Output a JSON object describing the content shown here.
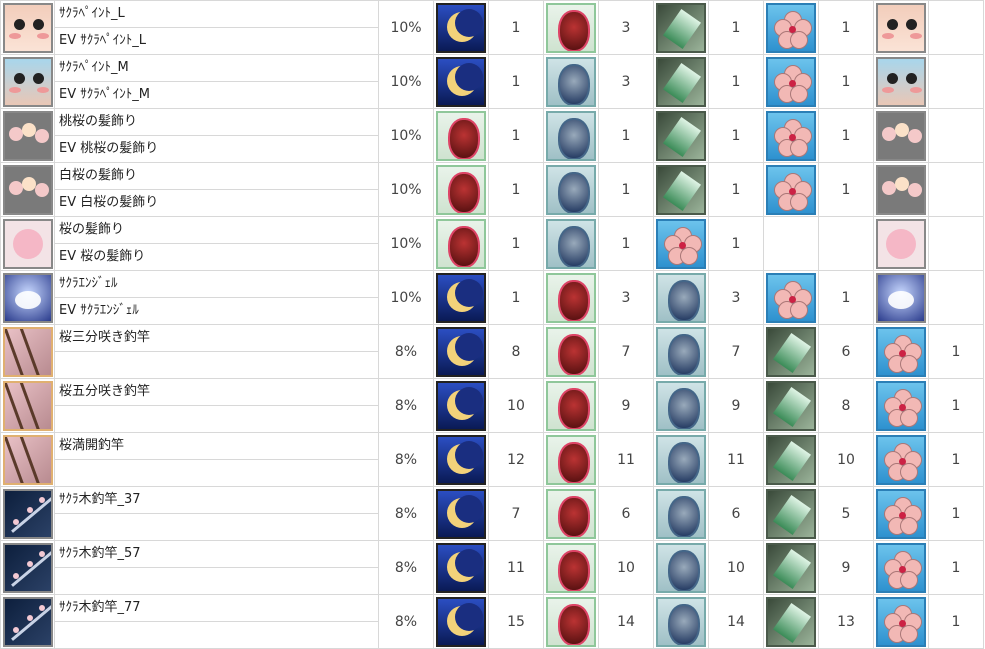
{
  "rows": [
    {
      "icon": "sakura-paint-l-icon",
      "icon_class": "sk-pink face",
      "name": "ｻｸﾗﾍﾟｲﾝﾄ_L",
      "ev": "EV ｻｸﾗﾍﾟｲﾝﾄ_L",
      "rate": "10%",
      "mats": [
        {
          "icon": "moon-icon",
          "qty": "1"
        },
        {
          "icon": "ruby-icon",
          "qty": "3"
        },
        {
          "icon": "emerald-icon",
          "qty": "1"
        },
        {
          "icon": "sakura-flower-icon",
          "qty": "1"
        }
      ],
      "result_icon": "sakura-paint-l-icon",
      "result_class": "sk-pink face",
      "result_qty": ""
    },
    {
      "icon": "sakura-paint-m-icon",
      "icon_class": "sk-blue face",
      "name": "ｻｸﾗﾍﾟｲﾝﾄ_M",
      "ev": "EV ｻｸﾗﾍﾟｲﾝﾄ_M",
      "rate": "10%",
      "mats": [
        {
          "icon": "moon-icon",
          "qty": "1"
        },
        {
          "icon": "sapphire-icon",
          "qty": "3"
        },
        {
          "icon": "emerald-icon",
          "qty": "1"
        },
        {
          "icon": "sakura-flower-icon",
          "qty": "1"
        }
      ],
      "result_icon": "sakura-paint-m-icon",
      "result_class": "sk-blue face",
      "result_qty": ""
    },
    {
      "icon": "peach-sakura-hair-ornament-icon",
      "icon_class": "hr-gray",
      "name": "桃桜の髪飾り",
      "ev": "EV 桃桜の髪飾り",
      "rate": "10%",
      "mats": [
        {
          "icon": "ruby-icon",
          "qty": "1"
        },
        {
          "icon": "sapphire-icon",
          "qty": "1"
        },
        {
          "icon": "emerald-icon",
          "qty": "1"
        },
        {
          "icon": "sakura-flower-icon",
          "qty": "1"
        }
      ],
      "result_icon": "peach-sakura-hair-ornament-icon",
      "result_class": "hr-gray",
      "result_qty": ""
    },
    {
      "icon": "white-sakura-hair-ornament-icon",
      "icon_class": "hr-gray",
      "name": "白桜の髪飾り",
      "ev": "EV 白桜の髪飾り",
      "rate": "10%",
      "mats": [
        {
          "icon": "ruby-icon",
          "qty": "1"
        },
        {
          "icon": "sapphire-icon",
          "qty": "1"
        },
        {
          "icon": "emerald-icon",
          "qty": "1"
        },
        {
          "icon": "sakura-flower-icon",
          "qty": "1"
        }
      ],
      "result_icon": "white-sakura-hair-ornament-icon",
      "result_class": "hr-gray",
      "result_qty": ""
    },
    {
      "icon": "sakura-hair-ornament-icon",
      "icon_class": "hr-pink",
      "name": "桜の髪飾り",
      "ev": "EV 桜の髪飾り",
      "rate": "10%",
      "mats": [
        {
          "icon": "ruby-icon",
          "qty": "1"
        },
        {
          "icon": "sapphire-icon",
          "qty": "1"
        },
        {
          "icon": "sakura-flower-icon",
          "qty": "1"
        },
        {
          "icon": "",
          "qty": ""
        }
      ],
      "result_icon": "sakura-hair-ornament-icon",
      "result_class": "hr-pink",
      "result_qty": ""
    },
    {
      "icon": "sakura-angel-icon",
      "icon_class": "an-blue",
      "name": "ｻｸﾗｴﾝｼﾞｪﾙ",
      "ev": "EV ｻｸﾗｴﾝｼﾞｪﾙ",
      "rate": "10%",
      "mats": [
        {
          "icon": "moon-icon",
          "qty": "1"
        },
        {
          "icon": "ruby-icon",
          "qty": "3"
        },
        {
          "icon": "sapphire-icon",
          "qty": "3"
        },
        {
          "icon": "sakura-flower-icon",
          "qty": "1"
        }
      ],
      "result_icon": "sakura-angel-icon",
      "result_class": "an-blue",
      "result_qty": ""
    },
    {
      "icon": "sakura-rod-30-icon",
      "icon_class": "rd-pink",
      "name": "桜三分咲き釣竿",
      "ev": "",
      "rate": "8%",
      "mats": [
        {
          "icon": "moon-icon",
          "qty": "8"
        },
        {
          "icon": "ruby-icon",
          "qty": "7"
        },
        {
          "icon": "sapphire-icon",
          "qty": "7"
        },
        {
          "icon": "emerald-icon",
          "qty": "6"
        }
      ],
      "result_icon": "sakura-flower-icon",
      "result_class": "sakura",
      "result_qty": "1"
    },
    {
      "icon": "sakura-rod-50-icon",
      "icon_class": "rd-pink",
      "name": "桜五分咲き釣竿",
      "ev": "",
      "rate": "8%",
      "mats": [
        {
          "icon": "moon-icon",
          "qty": "10"
        },
        {
          "icon": "ruby-icon",
          "qty": "9"
        },
        {
          "icon": "sapphire-icon",
          "qty": "9"
        },
        {
          "icon": "emerald-icon",
          "qty": "8"
        }
      ],
      "result_icon": "sakura-flower-icon",
      "result_class": "sakura",
      "result_qty": "1"
    },
    {
      "icon": "sakura-rod-full-icon",
      "icon_class": "rd-pink",
      "name": "桜満開釣竿",
      "ev": "",
      "rate": "8%",
      "mats": [
        {
          "icon": "moon-icon",
          "qty": "12"
        },
        {
          "icon": "ruby-icon",
          "qty": "11"
        },
        {
          "icon": "sapphire-icon",
          "qty": "11"
        },
        {
          "icon": "emerald-icon",
          "qty": "10"
        }
      ],
      "result_icon": "sakura-flower-icon",
      "result_class": "sakura",
      "result_qty": "1"
    },
    {
      "icon": "sakura-wood-rod-37-icon",
      "icon_class": "rd-night",
      "name": "ｻｸﾗ木釣竿_37",
      "ev": "",
      "rate": "8%",
      "mats": [
        {
          "icon": "moon-icon",
          "qty": "7"
        },
        {
          "icon": "ruby-icon",
          "qty": "6"
        },
        {
          "icon": "sapphire-icon",
          "qty": "6"
        },
        {
          "icon": "emerald-icon",
          "qty": "5"
        }
      ],
      "result_icon": "sakura-flower-icon",
      "result_class": "sakura",
      "result_qty": "1"
    },
    {
      "icon": "sakura-wood-rod-57-icon",
      "icon_class": "rd-night",
      "name": "ｻｸﾗ木釣竿_57",
      "ev": "",
      "rate": "8%",
      "mats": [
        {
          "icon": "moon-icon",
          "qty": "11"
        },
        {
          "icon": "ruby-icon",
          "qty": "10"
        },
        {
          "icon": "sapphire-icon",
          "qty": "10"
        },
        {
          "icon": "emerald-icon",
          "qty": "9"
        }
      ],
      "result_icon": "sakura-flower-icon",
      "result_class": "sakura",
      "result_qty": "1"
    },
    {
      "icon": "sakura-wood-rod-77-icon",
      "icon_class": "rd-night",
      "name": "ｻｸﾗ木釣竿_77",
      "ev": "",
      "rate": "8%",
      "mats": [
        {
          "icon": "moon-icon",
          "qty": "15"
        },
        {
          "icon": "ruby-icon",
          "qty": "14"
        },
        {
          "icon": "sapphire-icon",
          "qty": "14"
        },
        {
          "icon": "emerald-icon",
          "qty": "13"
        }
      ],
      "result_icon": "sakura-flower-icon",
      "result_class": "sakura",
      "result_qty": "1"
    }
  ]
}
